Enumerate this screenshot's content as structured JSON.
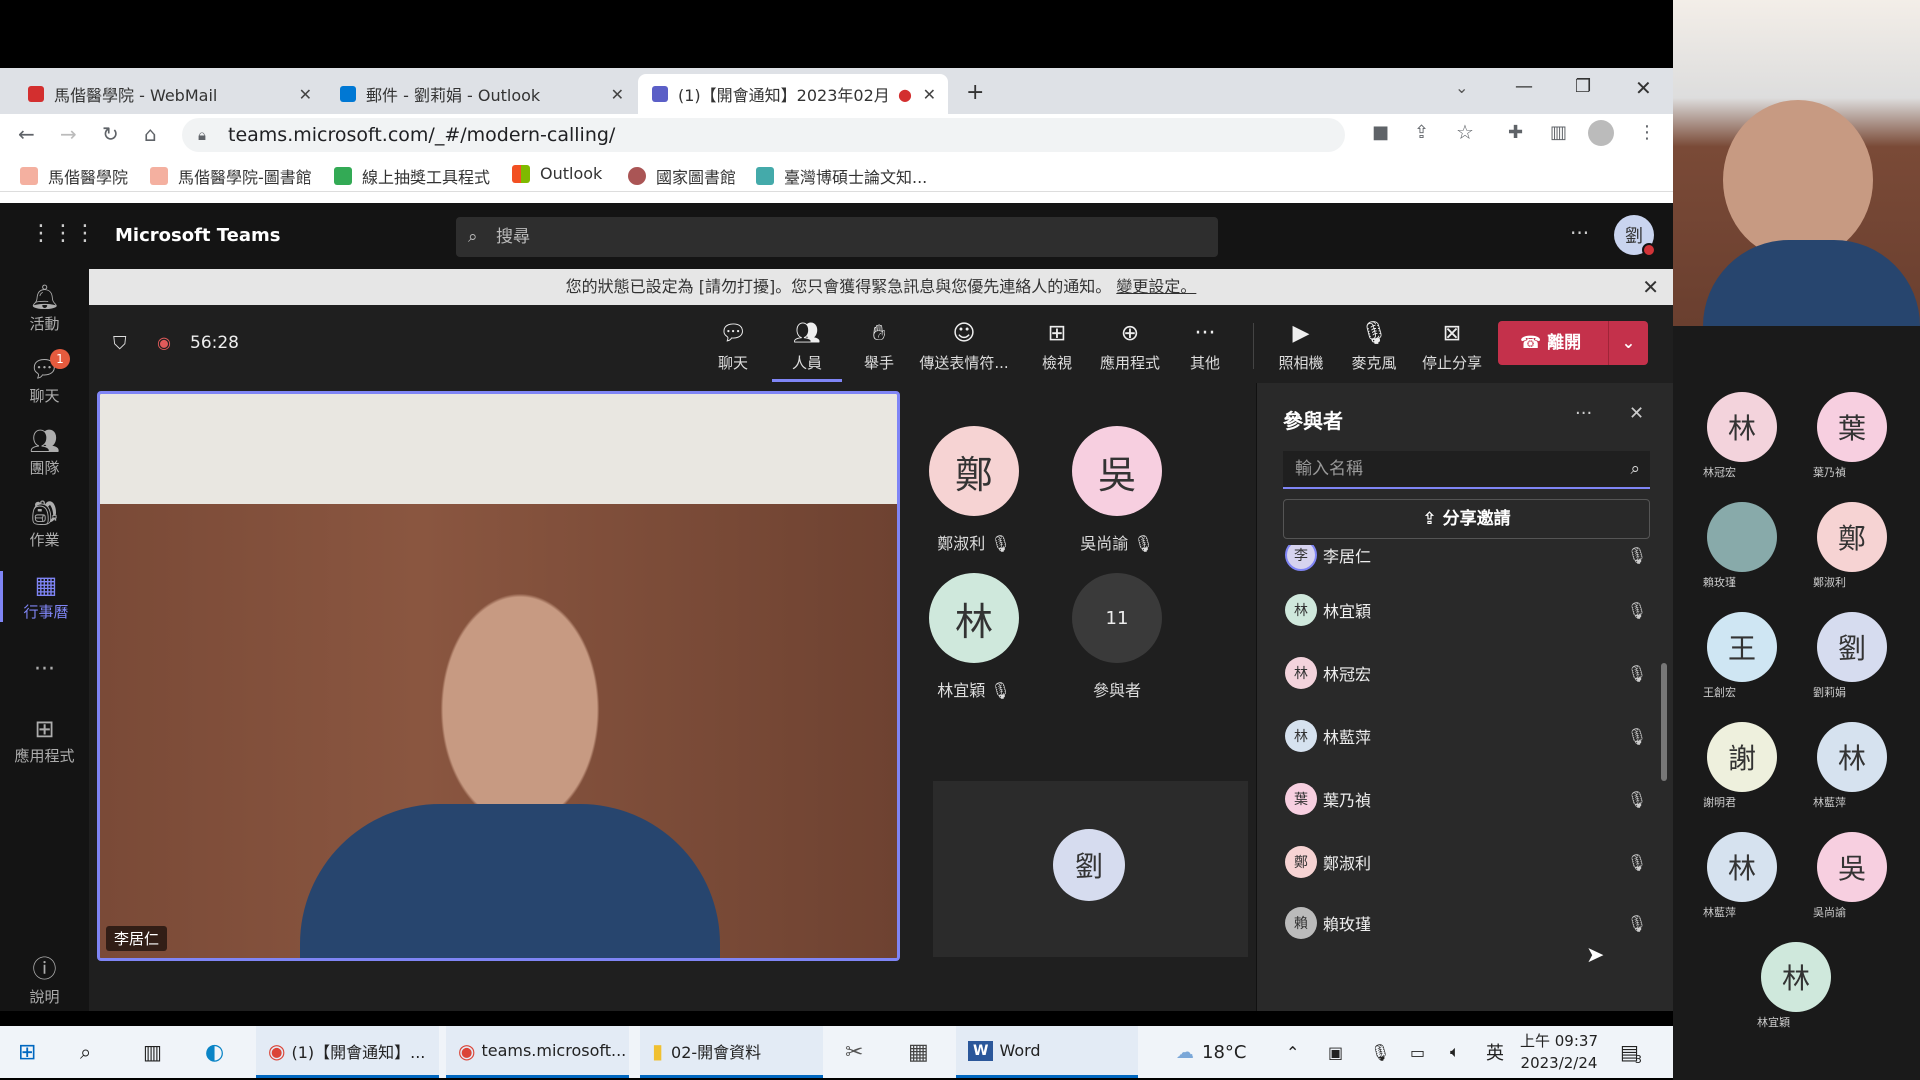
{
  "tabs": [
    {
      "label": "馬偕醫學院 - WebMail",
      "color": "#d32f2f"
    },
    {
      "label": "郵件 - 劉莉娟 - Outlook",
      "color": "#0078d4"
    },
    {
      "label": "(1)【開會通知】2023年02月",
      "color": "#5b5fc7"
    }
  ],
  "address": {
    "url": "teams.microsoft.com/_#/modern-calling/"
  },
  "bookmarks": [
    "馬偕醫學院",
    "馬偕醫學院-圖書館",
    "線上抽獎工具程式",
    "Outlook",
    "國家圖書館",
    "臺灣博碩士論文知..."
  ],
  "teams": {
    "app_name": "Microsoft Teams",
    "search_placeholder": "搜尋",
    "user_avatar": "劉",
    "rail": [
      {
        "label": "活動",
        "badge": ""
      },
      {
        "label": "聊天",
        "badge": "1"
      },
      {
        "label": "團隊",
        "badge": ""
      },
      {
        "label": "作業",
        "badge": ""
      },
      {
        "label": "行事曆",
        "badge": ""
      },
      {
        "label": "應用程式",
        "badge": ""
      },
      {
        "label": "說明",
        "badge": ""
      }
    ],
    "banner": {
      "text": "您的狀態已設定為 [請勿打擾]。您只會獲得緊急訊息與您優先連絡人的通知。",
      "link": "變更設定。"
    },
    "call": {
      "timer": "56:28",
      "buttons": [
        "聊天",
        "人員",
        "舉手",
        "傳送表情符...",
        "檢視",
        "應用程式",
        "其他",
        "照相機",
        "麥克風",
        "停止分享"
      ],
      "leave": "離開"
    },
    "main_video_name": "李居仁",
    "tiles": [
      {
        "initial": "鄭",
        "name": "鄭淑利",
        "color": "#f6d3d3"
      },
      {
        "initial": "吳",
        "name": "吳尚諭",
        "color": "#f7cfe0"
      },
      {
        "initial": "林",
        "name": "林宜穎",
        "color": "#cfe8dc"
      }
    ],
    "more_tile": {
      "count": "11",
      "label": "參與者"
    },
    "self_tile": {
      "initial": "劉",
      "color": "#d6dcef"
    },
    "panel": {
      "title": "參與者",
      "search_placeholder": "輸入名稱",
      "share_label": "分享邀請",
      "rows": [
        {
          "initial": "李",
          "name": "李居仁",
          "color": "#d6d3ef"
        },
        {
          "initial": "林",
          "name": "林宜穎",
          "color": "#cfe8dc"
        },
        {
          "initial": "林",
          "name": "林冠宏",
          "color": "#f3d3dc"
        },
        {
          "initial": "林",
          "name": "林藍萍",
          "color": "#d6e2ef"
        },
        {
          "initial": "葉",
          "name": "葉乃禎",
          "color": "#f7cfe0"
        },
        {
          "initial": "鄭",
          "name": "鄭淑利",
          "color": "#f6d3d3"
        },
        {
          "initial": "賴",
          "name": "賴玫瑾",
          "color": "#ddd"
        }
      ]
    }
  },
  "taskbar": {
    "items": [
      "(1)【開會通知】...",
      "teams.microsoft...",
      "02-開會資料",
      "Word"
    ],
    "weather": "18°C",
    "ime": "英",
    "time": "上午 09:37",
    "date": "2023/2/24",
    "notif": "3"
  },
  "gallery": [
    {
      "initial": "林",
      "name": "林冠宏",
      "color": "#f3d3dc"
    },
    {
      "initial": "葉",
      "name": "葉乃禎",
      "color": "#f7cfe0"
    },
    {
      "initial": "",
      "name": "賴玫瑾",
      "color": "#8aa"
    },
    {
      "initial": "鄭",
      "name": "鄭淑利",
      "color": "#f6d3d3"
    },
    {
      "initial": "王",
      "name": "王創宏",
      "color": "#cfe6f3"
    },
    {
      "initial": "劉",
      "name": "劉莉娟",
      "color": "#d6dcef"
    },
    {
      "initial": "謝",
      "name": "謝明君",
      "color": "#eef0dd"
    },
    {
      "initial": "林",
      "name": "林藍萍",
      "color": "#d6e2ef"
    },
    {
      "initial": "林",
      "name": "林藍萍",
      "color": "#d6e2ef"
    },
    {
      "initial": "吳",
      "name": "吳尚諭",
      "color": "#f7cfe0"
    },
    {
      "initial": "林",
      "name": "林宜穎",
      "color": "#cfe8dc"
    }
  ]
}
